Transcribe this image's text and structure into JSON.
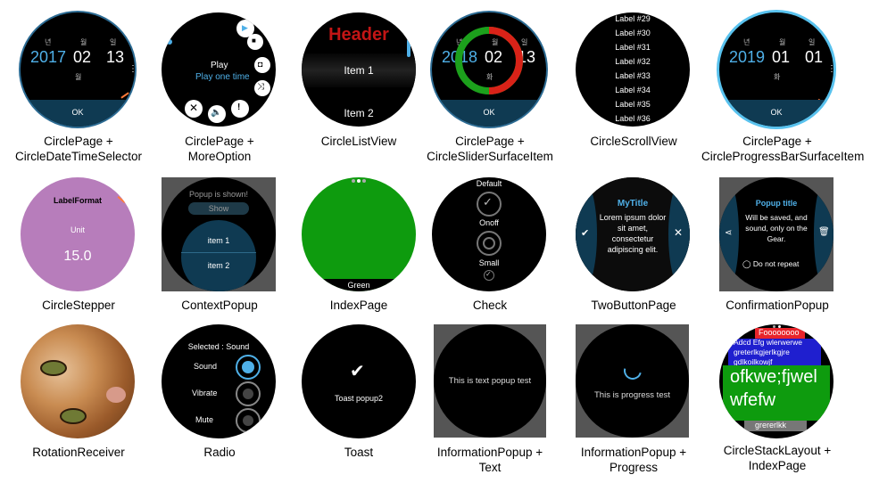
{
  "captions": [
    [
      "CirclePage +",
      "CircleDateTimeSelector"
    ],
    [
      "CirclePage +",
      "MoreOption"
    ],
    [
      "CircleListView"
    ],
    [
      "CirclePage +",
      "CircleSliderSurfaceItem"
    ],
    [
      "CircleScrollView"
    ],
    [
      "CirclePage +",
      "CircleProgressBarSurfaceItem"
    ],
    [
      "CircleStepper"
    ],
    [
      "ContextPopup"
    ],
    [
      "IndexPage"
    ],
    [
      "Check"
    ],
    [
      "TwoButtonPage"
    ],
    [
      "ConfirmationPopup"
    ],
    [
      "RotationReceiver"
    ],
    [
      "Radio"
    ],
    [
      "Toast"
    ],
    [
      "InformationPopup  +",
      "Text"
    ],
    [
      "InformationPopup  +",
      "Progress"
    ],
    [
      "CircleStackLayout  +",
      "IndexPage"
    ]
  ],
  "w1": {
    "h_year": "년",
    "h_month": "월",
    "h_day": "일",
    "year": "2017",
    "month": "02",
    "day": "13",
    "sub": "월",
    "ok": "OK"
  },
  "w2": {
    "title": "Play",
    "sub": "Play one time"
  },
  "w3": {
    "header": "Header",
    "item1": "Item 1",
    "item2": "Item 2"
  },
  "w4": {
    "h_year": "년",
    "h_month": "월",
    "h_day": "일",
    "year": "2018",
    "month": "02",
    "day": "13",
    "sub": "화",
    "ok": "OK"
  },
  "w5": {
    "labels": [
      "Label #29",
      "Label #30",
      "Label #31",
      "Label #32",
      "Label #33",
      "Label #34",
      "Label #35",
      "Label #36"
    ]
  },
  "w6": {
    "h_year": "년",
    "h_month": "월",
    "h_day": "일",
    "year": "2019",
    "month": "01",
    "day": "01",
    "sub": "화",
    "ok": "OK"
  },
  "w7": {
    "format": "LabelFormat",
    "unit": "Unit",
    "value": "15.0"
  },
  "w8": {
    "popup_text": "Popup is shown!",
    "show": "Show",
    "item1": "item 1",
    "item2": "item 2"
  },
  "w9": {
    "label": "Green"
  },
  "w10": {
    "default": "Default",
    "onoff": "Onoff",
    "small": "Small"
  },
  "w11": {
    "title": "MyTitle",
    "body": [
      "Lorem ipsum dolor",
      "sit amet,",
      "consectetur",
      "adipiscing elit."
    ]
  },
  "w12": {
    "title": "Popup title",
    "body": [
      "Will be saved, and",
      "sound, only on the",
      "Gear."
    ],
    "check": "Do not repeat"
  },
  "w14": {
    "selected": "Selected : Sound",
    "sound": "Sound",
    "vibrate": "Vibrate",
    "mute": "Mute"
  },
  "w15": {
    "text": "Toast popup2"
  },
  "w16": {
    "text": "This is text popup test"
  },
  "w17": {
    "text": "This is progress test"
  },
  "w18": {
    "red": "Foooooooo",
    "blue1": "Adcd Efg wlerwerwe",
    "blue2": "greterlkgjerlkgjre",
    "blue3": "gdlkoilkowjf",
    "green": [
      "ofkwe;fjwel",
      "wfefw"
    ],
    "gray": "grererlkk"
  },
  "colors": {
    "accent": "#4fb0e8",
    "blue_panel": "#0f3a52",
    "stepper": "#b77dbb",
    "green": "#0e9b0e",
    "slider_red": "#d92218",
    "slider_green": "#1ca01c"
  }
}
